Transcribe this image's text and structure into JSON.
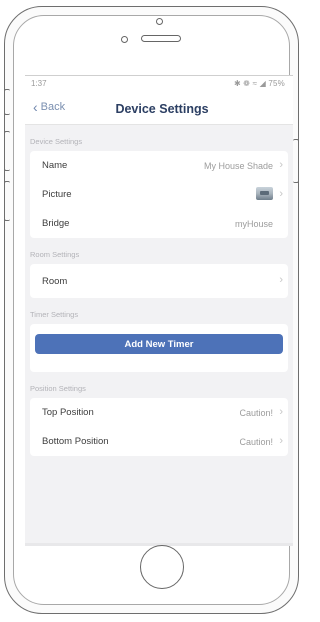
{
  "status_bar": {
    "time": "1:37",
    "right": "✱ ❁ ≈ ◢ 75%"
  },
  "nav": {
    "back_label": "Back",
    "title": "Device Settings"
  },
  "device_settings": {
    "section_label": "Device Settings",
    "rows": [
      {
        "label": "Name",
        "value": "My House Shade"
      },
      {
        "label": "Picture"
      },
      {
        "label": "Bridge",
        "value": "myHouse"
      }
    ]
  },
  "room_settings": {
    "section_label": "Room Settings",
    "rows": [
      {
        "label": "Room"
      }
    ]
  },
  "timer_settings": {
    "section_label": "Timer Settings",
    "add_button_label": "Add New Timer",
    "accent_color": "#4d72b8"
  },
  "position_settings": {
    "section_label": "Position Settings",
    "rows": [
      {
        "label": "Top Position",
        "value": "Caution!"
      },
      {
        "label": "Bottom Position",
        "value": "Caution!"
      }
    ]
  },
  "icons": {
    "back": "chevron-left-icon",
    "row_chevron": "chevron-right-icon",
    "picture_thumbnail": "shade-thumbnail-image"
  }
}
